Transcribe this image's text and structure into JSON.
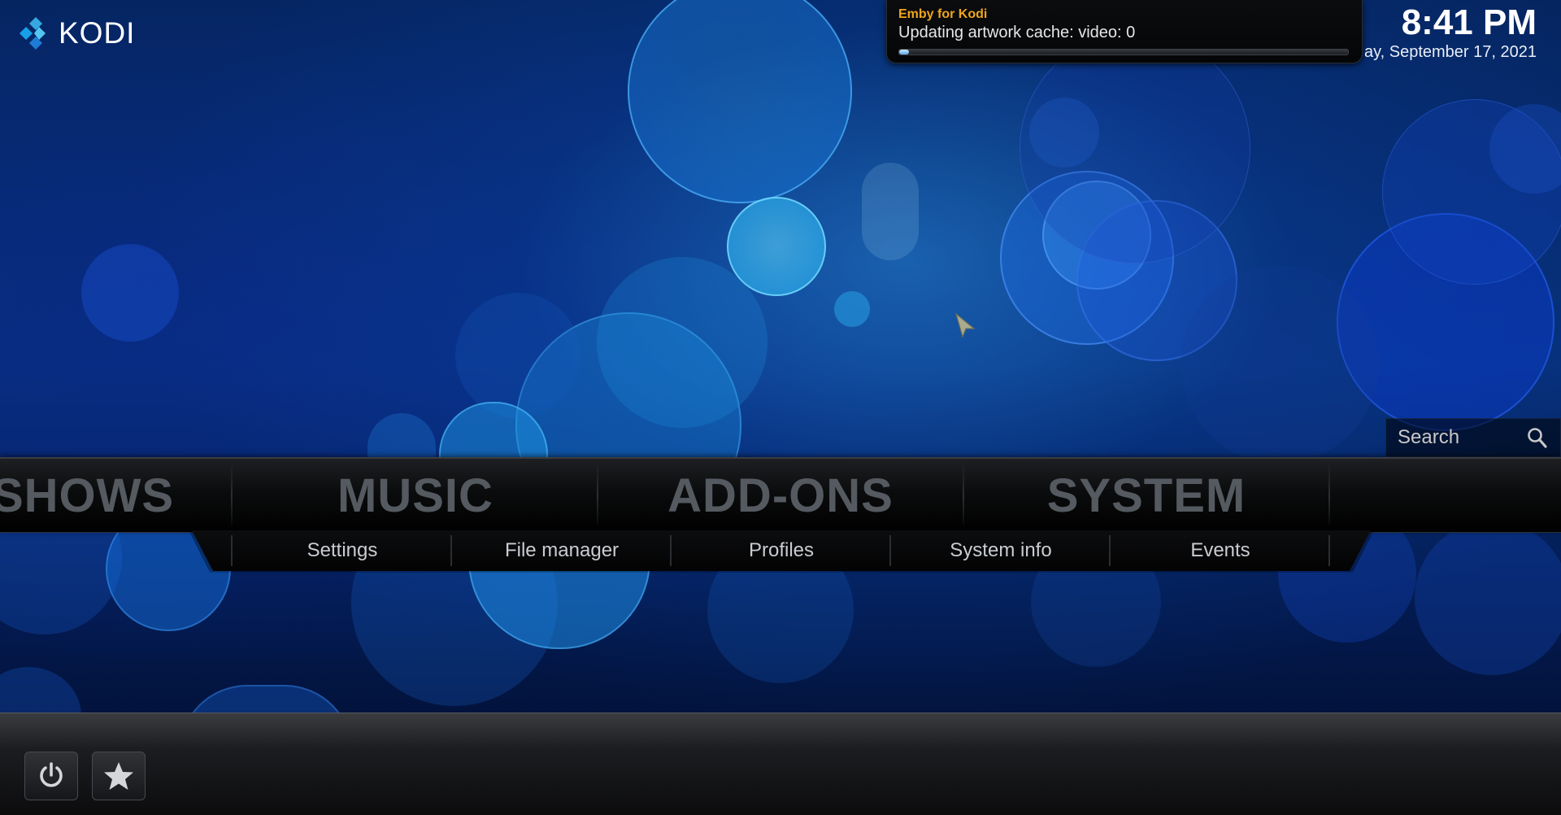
{
  "app": {
    "logo_text": "KODI",
    "logo_icon": "kodi-logo-icon"
  },
  "clock": {
    "time": "8:41 PM",
    "date": "ay, September 17, 2021"
  },
  "notification": {
    "title": "Emby for Kodi",
    "message": "Updating artwork cache: video: 0",
    "progress": 0.01
  },
  "search": {
    "label": "Search",
    "icon": "search-icon"
  },
  "main_menu": {
    "items": [
      {
        "label": "SHOWS"
      },
      {
        "label": "MUSIC"
      },
      {
        "label": "ADD-ONS"
      },
      {
        "label": "SYSTEM"
      }
    ]
  },
  "submenu": {
    "items": [
      {
        "label": "Settings"
      },
      {
        "label": "File manager"
      },
      {
        "label": "Profiles"
      },
      {
        "label": "System info"
      },
      {
        "label": "Events"
      }
    ]
  },
  "bottom_buttons": [
    {
      "icon": "power-icon"
    },
    {
      "icon": "star-icon"
    }
  ],
  "colors": {
    "notification_title": "#f0a51a",
    "menu_text": "#555a61",
    "background_accent": "#1e7bd6"
  }
}
